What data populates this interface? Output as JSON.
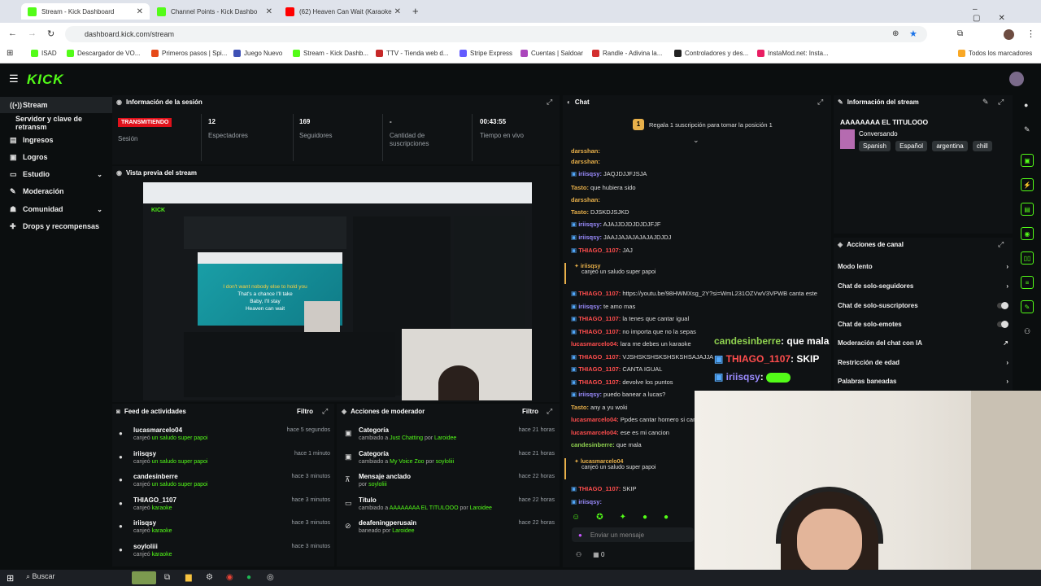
{
  "browser": {
    "tabs": [
      {
        "title": "Stream - Kick Dashboard",
        "color": "#53fc18",
        "active": true
      },
      {
        "title": "Channel Points - Kick Dashbo",
        "color": "#53fc18",
        "active": false
      },
      {
        "title": "(62) Heaven Can Wait (Karaoke",
        "color": "#ff0000",
        "active": false
      }
    ],
    "new_tab": "+",
    "url": "dashboard.kick.com/stream",
    "bookmarks": [
      {
        "label": "ISAD",
        "color": "#53fc18"
      },
      {
        "label": "Descargador de VO...",
        "color": "#53fc18"
      },
      {
        "label": "Primeros pasos | Spi...",
        "color": "#e64a19"
      },
      {
        "label": "Juego Nuevo",
        "color": "#3f51b5"
      },
      {
        "label": "Stream - Kick Dashb...",
        "color": "#53fc18"
      },
      {
        "label": "TTV - Tienda web d...",
        "color": "#c62828"
      },
      {
        "label": "Stripe Express",
        "color": "#635bff"
      },
      {
        "label": "Cuentas | Saldoar",
        "color": "#ab47bc"
      },
      {
        "label": "Randle - Adivina la...",
        "color": "#d32f2f"
      },
      {
        "label": "Controladores y des...",
        "color": "#222222"
      },
      {
        "label": "InstaMod.net: Insta...",
        "color": "#e91e63"
      }
    ],
    "all_bookmarks": "Todos los marcadores"
  },
  "brand": {
    "logo": "KICK",
    "accent": "#53fc18"
  },
  "sidebar": {
    "items": [
      {
        "label": "Stream",
        "icon": "signal-icon"
      },
      {
        "label": "Servidor y clave de retransm",
        "icon": ""
      },
      {
        "label": "Ingresos",
        "icon": "money-icon"
      },
      {
        "label": "Logros",
        "icon": "trophy-icon"
      },
      {
        "label": "Estudio",
        "icon": "studio-icon"
      },
      {
        "label": "Moderación",
        "icon": "wrench-icon"
      },
      {
        "label": "Comunidad",
        "icon": "people-icon"
      },
      {
        "label": "Drops y recompensas",
        "icon": "gift-icon"
      }
    ]
  },
  "session": {
    "title": "Información de la sesión",
    "status": "TRANSMITIENDO",
    "status_label": "Sesión",
    "stats": [
      {
        "value": "12",
        "label": "Espectadores"
      },
      {
        "value": "169",
        "label": "Seguidores"
      },
      {
        "value": "-",
        "label": "Cantidad de suscripciones"
      },
      {
        "value": "00:43:55",
        "label": "Tiempo en vivo"
      }
    ]
  },
  "preview": {
    "title": "Vista previa del stream",
    "lyrics": [
      "I don't want nobody else to hold you",
      "That's a chance I'll take",
      "Baby, I'll stay",
      "Heaven can wait"
    ]
  },
  "feed": {
    "title": "Feed de actividades",
    "filter": "Filtro",
    "items": [
      {
        "user": "lucasmarcelo04",
        "action": "canjeó",
        "reward": "un saludo super papoi",
        "time": "hace 5 segundos"
      },
      {
        "user": "iriisqsy",
        "action": "canjeó",
        "reward": "un saludo super papoi",
        "time": "hace 1 minuto"
      },
      {
        "user": "candesinberre",
        "action": "canjeó",
        "reward": "un saludo super papoi",
        "time": "hace 3 minutos"
      },
      {
        "user": "THIAGO_1107",
        "action": "canjeó",
        "reward": "karaoke",
        "time": "hace 3 minutos"
      },
      {
        "user": "iriisqsy",
        "action": "canjeó",
        "reward": "karaoke",
        "time": "hace 3 minutos"
      },
      {
        "user": "soyloliii",
        "action": "canjeó",
        "reward": "karaoke",
        "time": "hace 3 minutos"
      }
    ]
  },
  "modactions": {
    "title": "Acciones de moderador",
    "filter": "Filtro",
    "items": [
      {
        "title": "Categoría",
        "pre": "cambiado a",
        "value": "Just Chatting",
        "by": "por",
        "mod": "Laroidee",
        "time": "hace 21 horas"
      },
      {
        "title": "Categoría",
        "pre": "cambiado a",
        "value": "My Voice Zoo",
        "by": "por",
        "mod": "soyloliii",
        "time": "hace 21 horas"
      },
      {
        "title": "Mensaje anclado",
        "pre": "por",
        "value": "soyloliii",
        "by": "",
        "mod": "",
        "time": "hace 22 horas"
      },
      {
        "title": "Título",
        "pre": "cambiado a",
        "value": "AAAAAAAA EL TITULOOO",
        "by": "por",
        "mod": "Laroidee",
        "time": "hace 22 horas"
      },
      {
        "title": "deafeningperusain",
        "pre": "baneado por",
        "value": "Laroidee",
        "by": "",
        "mod": "",
        "time": "hace 22 horas"
      }
    ]
  },
  "chat": {
    "title": "Chat",
    "pinned": "Regala 1 suscripción para tomar la posición 1",
    "placeholder": "Enviar un mensaje",
    "counter": "0",
    "messages": [
      {
        "user": "darsshan:",
        "text": "",
        "color": "#e8b04a"
      },
      {
        "user": "darsshan:",
        "text": "",
        "color": "#e8b04a"
      },
      {
        "user": "iriisqsy:",
        "text": "JAQJDJJFJSJA",
        "color": "#9b8cff"
      },
      {
        "user": "Tasto:",
        "text": "que hubiera sido",
        "color": "#e8b04a"
      },
      {
        "user": "darsshan:",
        "text": "",
        "color": "#e8b04a"
      },
      {
        "user": "Tasto:",
        "text": "DJSKDJSJKD",
        "color": "#e8b04a"
      },
      {
        "user": "iriisqsy:",
        "text": "AJAJJDJDJDJDJFJF",
        "color": "#9b8cff"
      },
      {
        "user": "iriisqsy:",
        "text": "JAAJJAJAJAJAJAJDJDJ",
        "color": "#9b8cff"
      },
      {
        "user": "THIAGO_1107:",
        "text": "JAJ",
        "color": "#ff4d4d"
      }
    ],
    "redeem1": {
      "user": "iriisqsy",
      "text": "canjeó un saludo super papoi"
    },
    "messages2": [
      {
        "user": "THIAGO_1107:",
        "text": "https://youtu.be/98HWMXsg_2Y?si=WmL231OZVwV3VPWB canta este",
        "color": "#ff4d4d"
      },
      {
        "user": "iriisqsy:",
        "text": "te amo mas",
        "color": "#9b8cff"
      },
      {
        "user": "THIAGO_1107:",
        "text": "la tenes que cantar igual",
        "color": "#ff4d4d"
      },
      {
        "user": "THIAGO_1107:",
        "text": "no importa que no la sepas",
        "color": "#ff4d4d"
      },
      {
        "user": "lucasmarcelo04:",
        "text": "lara me debes un karaoke",
        "color": "#ff4d4d"
      },
      {
        "user": "THIAGO_1107:",
        "text": "VJSHSKSHSKSHSKSHSAJAJJA",
        "color": "#ff4d4d"
      },
      {
        "user": "THIAGO_1107:",
        "text": "CANTA IGUAL",
        "color": "#ff4d4d"
      },
      {
        "user": "THIAGO_1107:",
        "text": "devolve los puntos",
        "color": "#ff4d4d"
      },
      {
        "user": "iriisqsy:",
        "text": "puedo banear a lucas?",
        "color": "#9b8cff"
      },
      {
        "user": "Tasto:",
        "text": "any a yu woki",
        "color": "#e8b04a"
      },
      {
        "user": "lucasmarcelo04:",
        "text": "Ppdes cantar homero si can",
        "color": "#ff4d4d"
      },
      {
        "user": "lucasmarcelo04:",
        "text": "ese es mi cancion",
        "color": "#ff4d4d"
      },
      {
        "user": "candesinberre:",
        "text": "que mala",
        "color": "#8fd14f"
      }
    ],
    "redeem2": {
      "user": "lucasmarcelo04",
      "text": "canjeó un saludo super papoi"
    },
    "messages3": [
      {
        "user": "THIAGO_1107:",
        "text": "SKIP",
        "color": "#ff4d4d"
      },
      {
        "user": "iriisqsy:",
        "text": "",
        "color": "#9b8cff"
      }
    ]
  },
  "overlay_chat": [
    {
      "user": "candesinberre",
      "text": ": que mala",
      "color": "#8fd14f"
    },
    {
      "user": "THIAGO_1107",
      "text": ": SKIP",
      "color": "#ff4d4d"
    },
    {
      "user": "iriisqsy",
      "text": ":",
      "color": "#9b8cff"
    }
  ],
  "stream_info": {
    "title": "Información del stream",
    "stream_title": "AAAAAAAA EL TITULOOO",
    "category": "Conversando",
    "tags": [
      "Spanish",
      "Español",
      "argentina",
      "chill"
    ]
  },
  "channel_actions": {
    "title": "Acciones de canal",
    "items": [
      {
        "label": "Modo lento",
        "kind": "chevron"
      },
      {
        "label": "Chat de solo-seguidores",
        "kind": "chevron"
      },
      {
        "label": "Chat de solo-suscriptores",
        "kind": "toggle"
      },
      {
        "label": "Chat de solo-emotes",
        "kind": "toggle"
      },
      {
        "label": "Moderación del chat con IA",
        "kind": "link"
      },
      {
        "label": "Restricción de edad",
        "kind": "chevron"
      },
      {
        "label": "Palabras baneadas",
        "kind": "chevron"
      }
    ]
  },
  "taskbar": {
    "search": "Buscar"
  }
}
